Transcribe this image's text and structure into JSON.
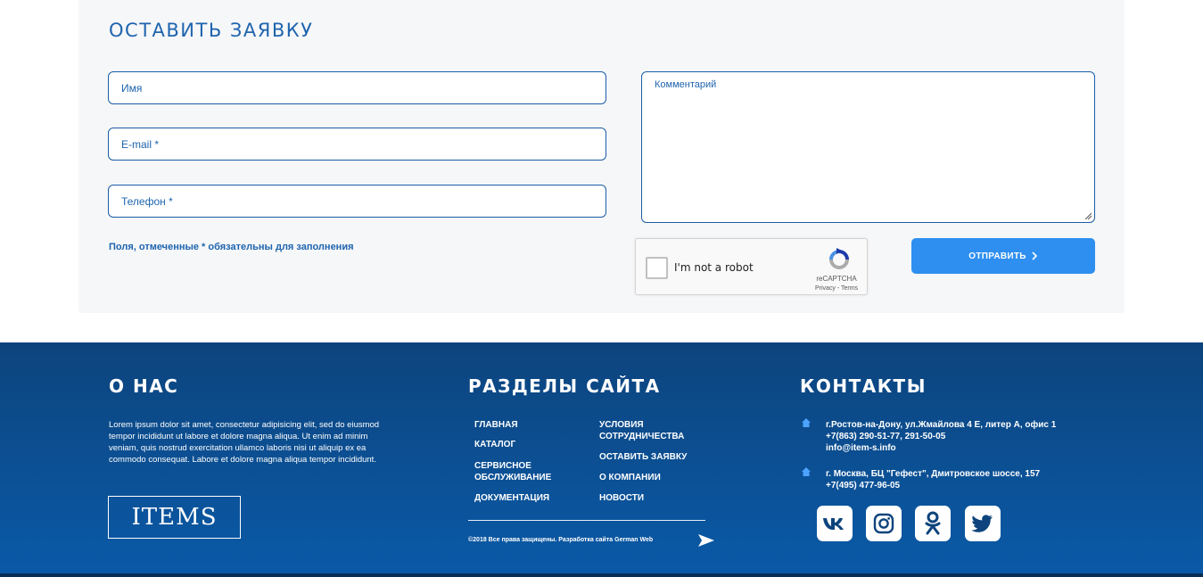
{
  "form": {
    "title": "Оставить заявку",
    "name_placeholder": "Имя",
    "email_placeholder": "E-mail *",
    "phone_placeholder": "Телефон *",
    "comment_placeholder": "Комментарий",
    "required_note": "Поля, отмеченные * обязательны для заполнения",
    "submit_label": "Отправить"
  },
  "recaptcha": {
    "label": "I'm not a robot",
    "brand": "reCAPTCHA",
    "links": "Privacy - Terms"
  },
  "footer": {
    "about": {
      "title": "О нас",
      "text": "Lorem ipsum dolor sit amet, consectetur adipisicing elit, sed do eiusmod tempor incididunt ut labore et dolore magna aliqua. Ut enim ad minim veniam, quis nostrud exercitation ullamco laboris nisi ut aliquip ex ea commodo consequat. Labore et dolore magna aliqua tempor incididunt.",
      "logo_text": "ITEMS"
    },
    "sections": {
      "title": "Разделы сайта",
      "col1": [
        "Главная",
        "Каталог",
        "Сервисное обслуживание",
        "Документация"
      ],
      "col2": [
        "Условия сотрудничества",
        "Оставить заявку",
        "О компании",
        "Новости"
      ],
      "copyright": "©2018 Все права защищены. Разработка сайта German Web"
    },
    "contacts": {
      "title": "Контакты",
      "office1": {
        "address": "г.Ростов-на-Дону, ул.Жмайлова 4 Е, литер А, офис 1",
        "phones": "+7(863) 290-51-77, 291-50-05",
        "email": "info@item-s.info"
      },
      "office2": {
        "address": "г. Москва, БЦ \"Гефест\", Дмитровское шоссе, 157",
        "phones": "+7(495) 477-96-05"
      },
      "social": [
        "vk-icon",
        "instagram-icon",
        "odnoklassniki-icon",
        "twitter-icon"
      ]
    }
  },
  "colors": {
    "accent": "#1f64ae",
    "button": "#2e8ff0",
    "footer_top": "#0d447d",
    "footer_bottom": "#0a5aa8"
  }
}
